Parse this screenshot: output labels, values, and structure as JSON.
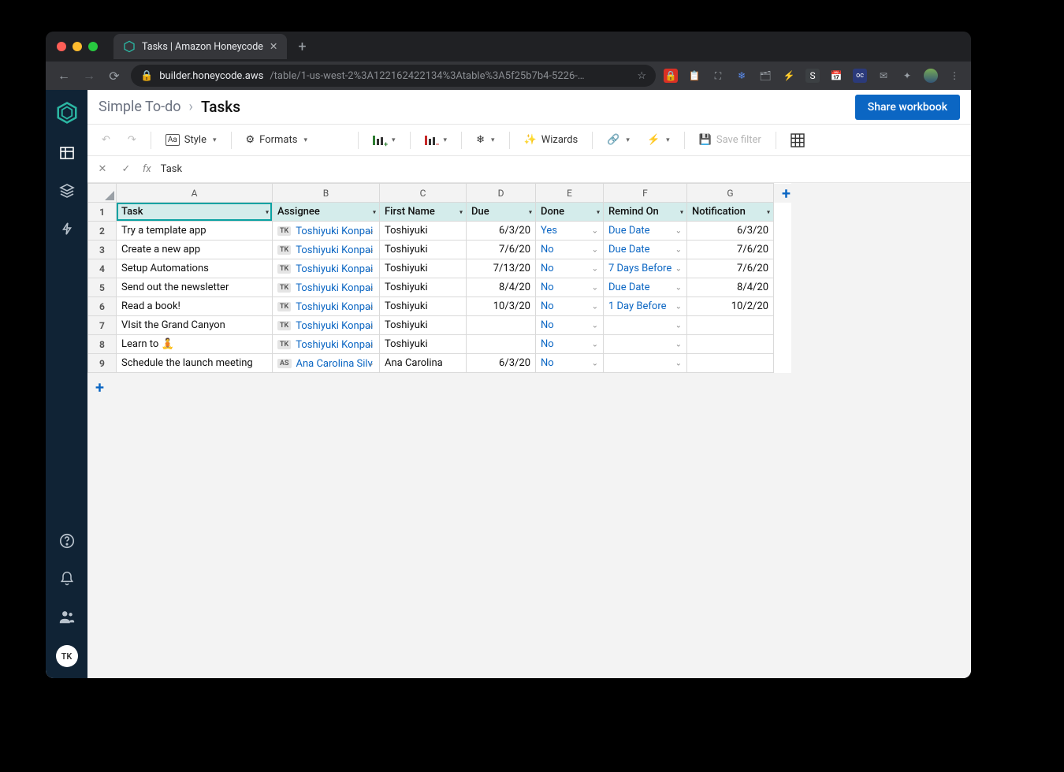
{
  "browser": {
    "tab_title": "Tasks | Amazon Honeycode",
    "url_host": "builder.honeycode.aws",
    "url_path": "/table/1-us-west-2%3A122162422134%3Atable%3A5f25b7b4-5226-…"
  },
  "breadcrumb": {
    "root": "Simple To-do",
    "current": "Tasks"
  },
  "buttons": {
    "share": "Share workbook",
    "style": "Style",
    "formats": "Formats",
    "wizards": "Wizards",
    "save_filter": "Save filter"
  },
  "formula_bar": {
    "value": "Task"
  },
  "columns": [
    "A",
    "B",
    "C",
    "D",
    "E",
    "F",
    "G"
  ],
  "field_headers": [
    "Task",
    "Assignee",
    "First Name",
    "Due",
    "Done",
    "Remind On",
    "Notification"
  ],
  "rows": [
    {
      "n": 2,
      "task": "Try a template app",
      "ini": "TK",
      "assignee": "Toshiyuki Konpai",
      "first": "Toshiyuki",
      "due": "6/3/20",
      "done": "Yes",
      "remind": "Due Date",
      "notif": "6/3/20"
    },
    {
      "n": 3,
      "task": "Create a new app",
      "ini": "TK",
      "assignee": "Toshiyuki Konpai",
      "first": "Toshiyuki",
      "due": "7/6/20",
      "done": "No",
      "remind": "Due Date",
      "notif": "7/6/20"
    },
    {
      "n": 4,
      "task": "Setup Automations",
      "ini": "TK",
      "assignee": "Toshiyuki Konpai",
      "first": "Toshiyuki",
      "due": "7/13/20",
      "done": "No",
      "remind": "7 Days Before",
      "notif": "7/6/20"
    },
    {
      "n": 5,
      "task": "Send out the newsletter",
      "ini": "TK",
      "assignee": "Toshiyuki Konpai",
      "first": "Toshiyuki",
      "due": "8/4/20",
      "done": "No",
      "remind": "Due Date",
      "notif": "8/4/20"
    },
    {
      "n": 6,
      "task": "Read a book!",
      "ini": "TK",
      "assignee": "Toshiyuki Konpai",
      "first": "Toshiyuki",
      "due": "10/3/20",
      "done": "No",
      "remind": "1 Day Before",
      "notif": "10/2/20"
    },
    {
      "n": 7,
      "task": "VIsit the Grand Canyon",
      "ini": "TK",
      "assignee": "Toshiyuki Konpai",
      "first": "Toshiyuki",
      "due": "",
      "done": "No",
      "remind": "",
      "notif": ""
    },
    {
      "n": 8,
      "task": "Learn to 🧘",
      "ini": "TK",
      "assignee": "Toshiyuki Konpai",
      "first": "Toshiyuki",
      "due": "",
      "done": "No",
      "remind": "",
      "notif": ""
    },
    {
      "n": 9,
      "task": "Schedule the launch meeting",
      "ini": "AS",
      "assignee": "Ana Carolina Silv",
      "first": "Ana Carolina",
      "due": "6/3/20",
      "done": "No",
      "remind": "",
      "notif": ""
    }
  ],
  "user_initials": "TK"
}
